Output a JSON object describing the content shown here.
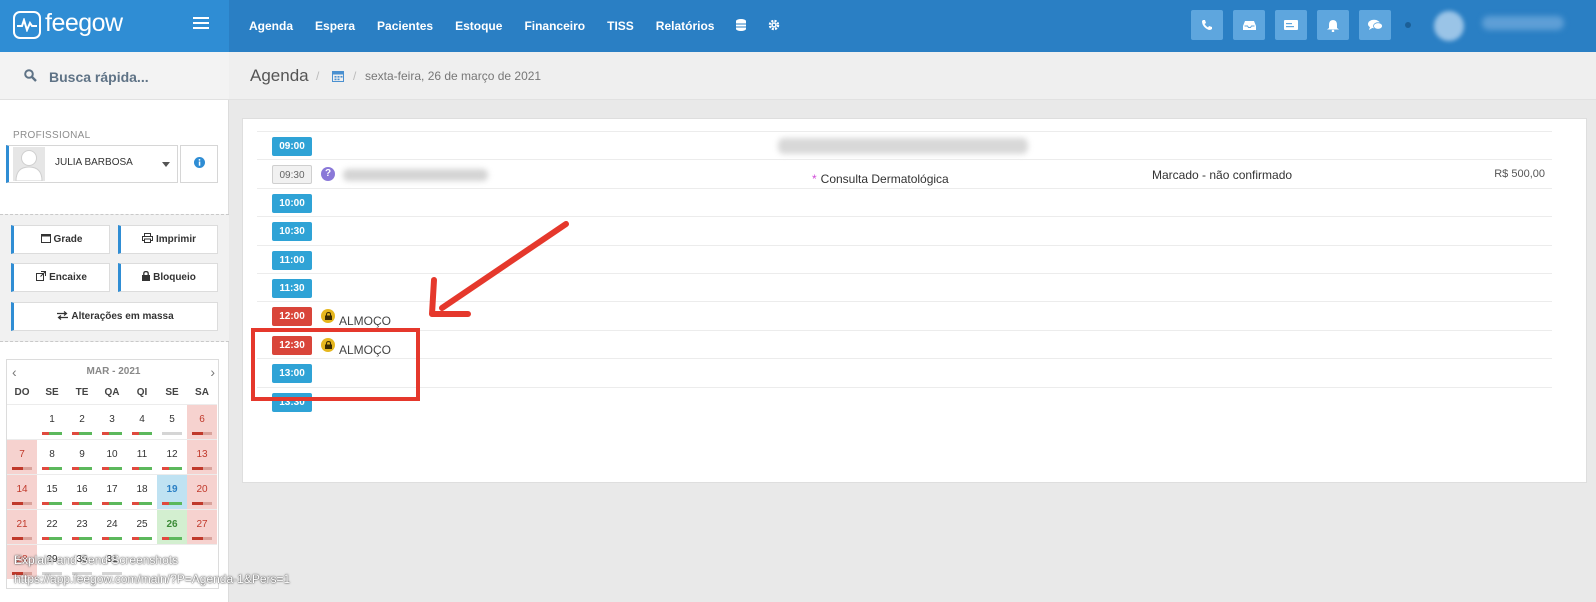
{
  "brand": {
    "name": "feegow"
  },
  "nav": {
    "items": [
      "Agenda",
      "Espera",
      "Pacientes",
      "Estoque",
      "Financeiro",
      "TISS",
      "Relatórios"
    ],
    "icons": [
      "database-icon",
      "gear-icon"
    ]
  },
  "top_actions": [
    "phone-icon",
    "inbox-icon",
    "card-icon",
    "bell-icon",
    "chat-icon"
  ],
  "sidebar": {
    "search_label": "Busca rápida...",
    "prof_label": "PROFISSIONAL",
    "prof_name": "JULIA BARBOSA",
    "buttons": {
      "grade": "Grade",
      "imprimir": "Imprimir",
      "encaixe": "Encaixe",
      "bloqueio": "Bloqueio",
      "massa": "Alterações em massa"
    },
    "calendar": {
      "title": "MAR - 2021",
      "dow": [
        "DO",
        "SE",
        "TE",
        "QA",
        "QI",
        "SE",
        "SA"
      ],
      "weeks": [
        [
          "",
          "1",
          "2",
          "3",
          "4",
          "5",
          "6"
        ],
        [
          "7",
          "8",
          "9",
          "10",
          "11",
          "12",
          "13"
        ],
        [
          "14",
          "15",
          "16",
          "17",
          "18",
          "19",
          "20"
        ],
        [
          "21",
          "22",
          "23",
          "24",
          "25",
          "26",
          "27"
        ],
        [
          "28",
          "29",
          "30",
          "31",
          "",
          "",
          ""
        ]
      ]
    }
  },
  "breadcrumb": {
    "title": "Agenda",
    "date": "sexta-feira, 26 de março de 2021"
  },
  "schedule": {
    "rows": [
      {
        "time": "09:00",
        "style": "blue"
      },
      {
        "time": "09:30",
        "style": "grey",
        "procedure": "Consulta Dermatológica",
        "status": "Marcado - não confirmado",
        "price": "R$ 500,00"
      },
      {
        "time": "10:00",
        "style": "blue"
      },
      {
        "time": "10:30",
        "style": "blue"
      },
      {
        "time": "11:00",
        "style": "blue"
      },
      {
        "time": "11:30",
        "style": "blue"
      },
      {
        "time": "12:00",
        "style": "red",
        "block": "ALMOÇO"
      },
      {
        "time": "12:30",
        "style": "red",
        "block": "ALMOÇO"
      },
      {
        "time": "13:00",
        "style": "blue"
      },
      {
        "time": "13:30",
        "style": "blue"
      }
    ]
  },
  "overlay": {
    "line1": "Explain and Send Screenshots",
    "line2": "https://app.feegow.com/main/?P=Agenda-1&Pers=1"
  },
  "colors": {
    "primary": "#2a7fc4",
    "slot_free": "#2fa3d6",
    "slot_blocked": "#d9453a",
    "highlight": "#e5382c"
  }
}
